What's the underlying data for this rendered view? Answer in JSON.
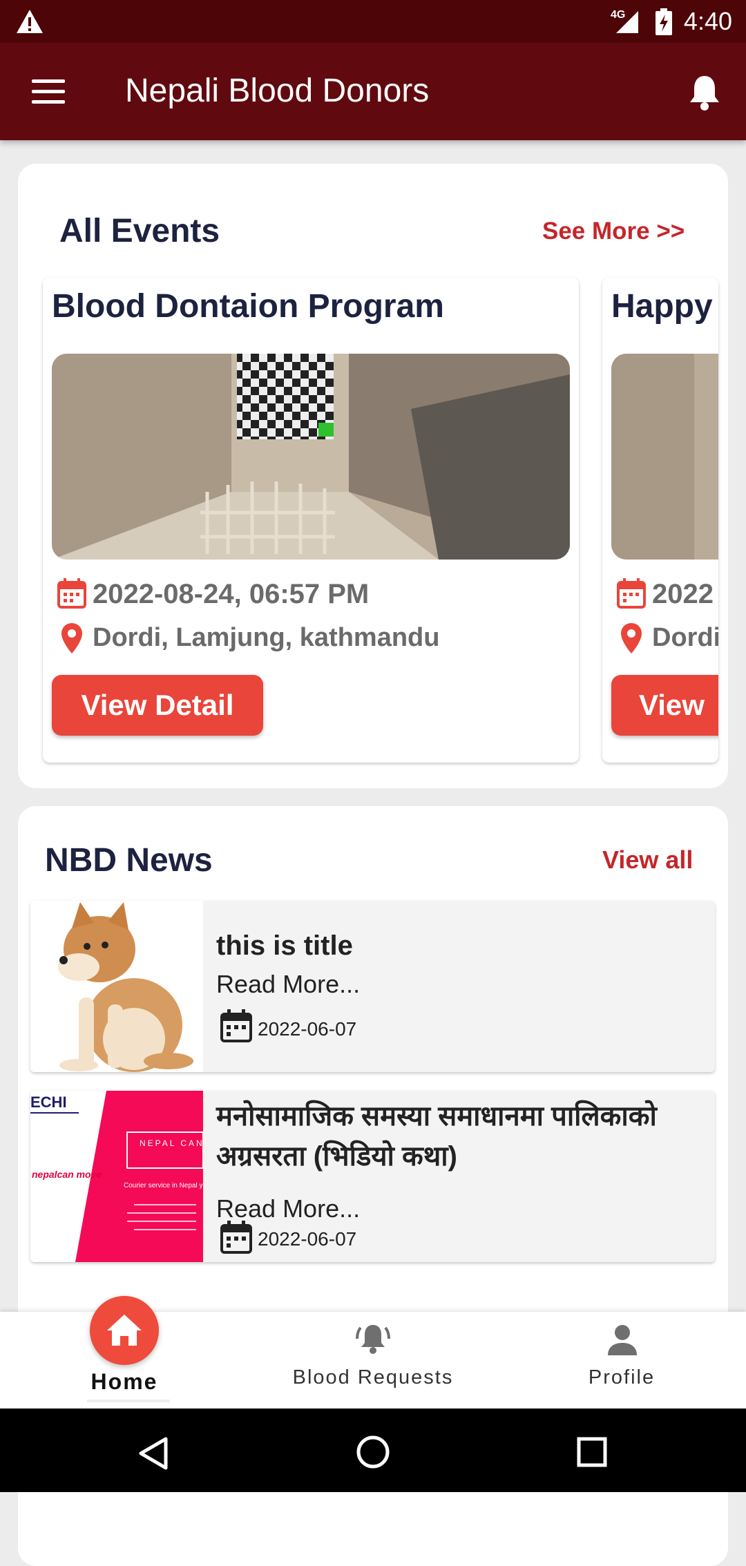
{
  "status_bar": {
    "time": "4:40",
    "network": "4G",
    "icons": [
      "warning-icon",
      "signal-icon",
      "battery-charging-icon"
    ]
  },
  "app_bar": {
    "title": "Nepali Blood Donors",
    "menu_icon": "hamburger-menu-icon",
    "bell_icon": "notification-bell-icon"
  },
  "events": {
    "title": "All Events",
    "see_more": "See More >>",
    "items": [
      {
        "title": "Blood Dontaion Program",
        "date": "2022-08-24, 06:57 PM",
        "location": "Dordi, Lamjung, kathmandu",
        "button": "View Detail"
      },
      {
        "title": "Happy",
        "date": "2022",
        "location": "Dordi",
        "button": "View"
      }
    ]
  },
  "news": {
    "title": "NBD News",
    "view_all": "View all",
    "items": [
      {
        "title": "this is title",
        "read_more": "Read More...",
        "date": "2022-06-07"
      },
      {
        "title": "मनोसामाजिक समस्या समाधानमा पालिकाको अग्रसरता (भिडियो कथा)",
        "read_more": "Read More...",
        "date": "2022-06-07",
        "thumb_texts": [
          "ECHI",
          "NEPAL CAN MOVE",
          "nepalcan move",
          "Courier service in Nepal you can trust"
        ]
      }
    ]
  },
  "bottom_nav": {
    "items": [
      {
        "label": "Home",
        "icon": "home-icon",
        "active": true
      },
      {
        "label": "Blood Requests",
        "icon": "bell-ringing-icon",
        "active": false
      },
      {
        "label": "Profile",
        "icon": "person-icon",
        "active": false
      }
    ]
  },
  "colors": {
    "status_bar": "#4d0508",
    "app_bar": "#600a0f",
    "accent": "#e9453a",
    "link": "#c4262a",
    "heading": "#1d2240"
  }
}
